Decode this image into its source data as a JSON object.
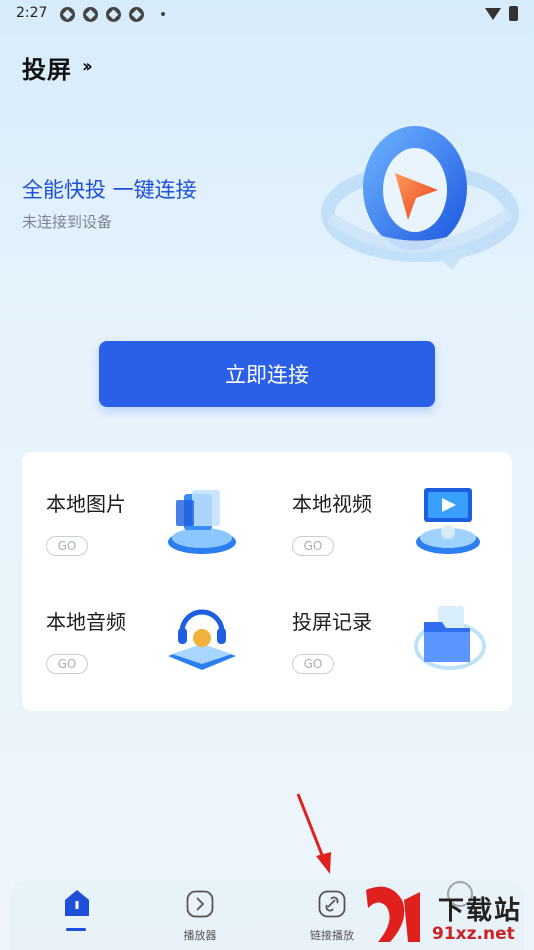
{
  "status_bar": {
    "time": "2:27"
  },
  "header": {
    "title": "投屏",
    "chevrons": "››"
  },
  "hero": {
    "slogan": "全能快投 一键连接",
    "connection_status": "未连接到设备"
  },
  "connect_button": {
    "label": "立即连接"
  },
  "features": [
    {
      "label": "本地图片",
      "badge": "GO",
      "icon": "photo-icon"
    },
    {
      "label": "本地视频",
      "badge": "GO",
      "icon": "video-icon"
    },
    {
      "label": "本地音频",
      "badge": "GO",
      "icon": "audio-icon"
    },
    {
      "label": "投屏记录",
      "badge": "GO",
      "icon": "folder-icon"
    }
  ],
  "bottom_nav": [
    {
      "label": "",
      "icon": "home-icon",
      "active": true
    },
    {
      "label": "播放器",
      "icon": "play-icon",
      "active": false
    },
    {
      "label": "链接播放",
      "icon": "link-icon",
      "active": false
    }
  ],
  "watermark": {
    "text": "下载站",
    "url": "91xz.net"
  },
  "colors": {
    "accent": "#2a5fe8",
    "slogan": "#1d4fd8",
    "arrow": "#e0201c"
  }
}
